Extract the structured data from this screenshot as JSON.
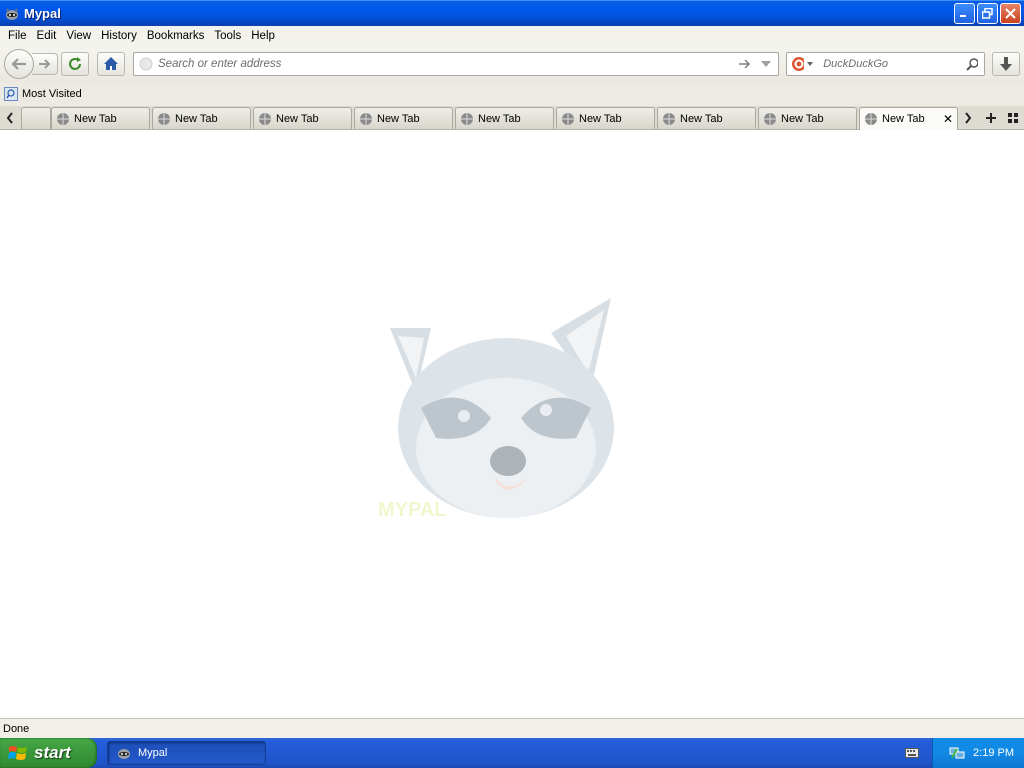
{
  "window": {
    "title": "Mypal"
  },
  "menu": {
    "items": [
      {
        "label": "File"
      },
      {
        "label": "Edit"
      },
      {
        "label": "View"
      },
      {
        "label": "History"
      },
      {
        "label": "Bookmarks"
      },
      {
        "label": "Tools"
      },
      {
        "label": "Help"
      }
    ]
  },
  "navbar": {
    "url_placeholder": "Search or enter address",
    "search_engine": "DuckDuckGo",
    "search_placeholder": "DuckDuckGo"
  },
  "bookmarks": {
    "items": [
      {
        "label": "Most Visited"
      }
    ]
  },
  "tabs": [
    {
      "label": "New Tab"
    },
    {
      "label": "New Tab"
    },
    {
      "label": "New Tab"
    },
    {
      "label": "New Tab"
    },
    {
      "label": "New Tab"
    },
    {
      "label": "New Tab"
    },
    {
      "label": "New Tab"
    },
    {
      "label": "New Tab"
    },
    {
      "label": "New Tab",
      "selected": true
    }
  ],
  "content": {
    "logo_text": "MYPAL"
  },
  "status": {
    "text": "Done"
  },
  "taskbar": {
    "start_label": "start",
    "task_label": "Mypal",
    "clock": "2:19 PM"
  },
  "colors": {
    "titlebar": "#0058ee",
    "taskbar": "#245edc",
    "start": "#3c9a3c",
    "tray": "#0f8ce8"
  }
}
